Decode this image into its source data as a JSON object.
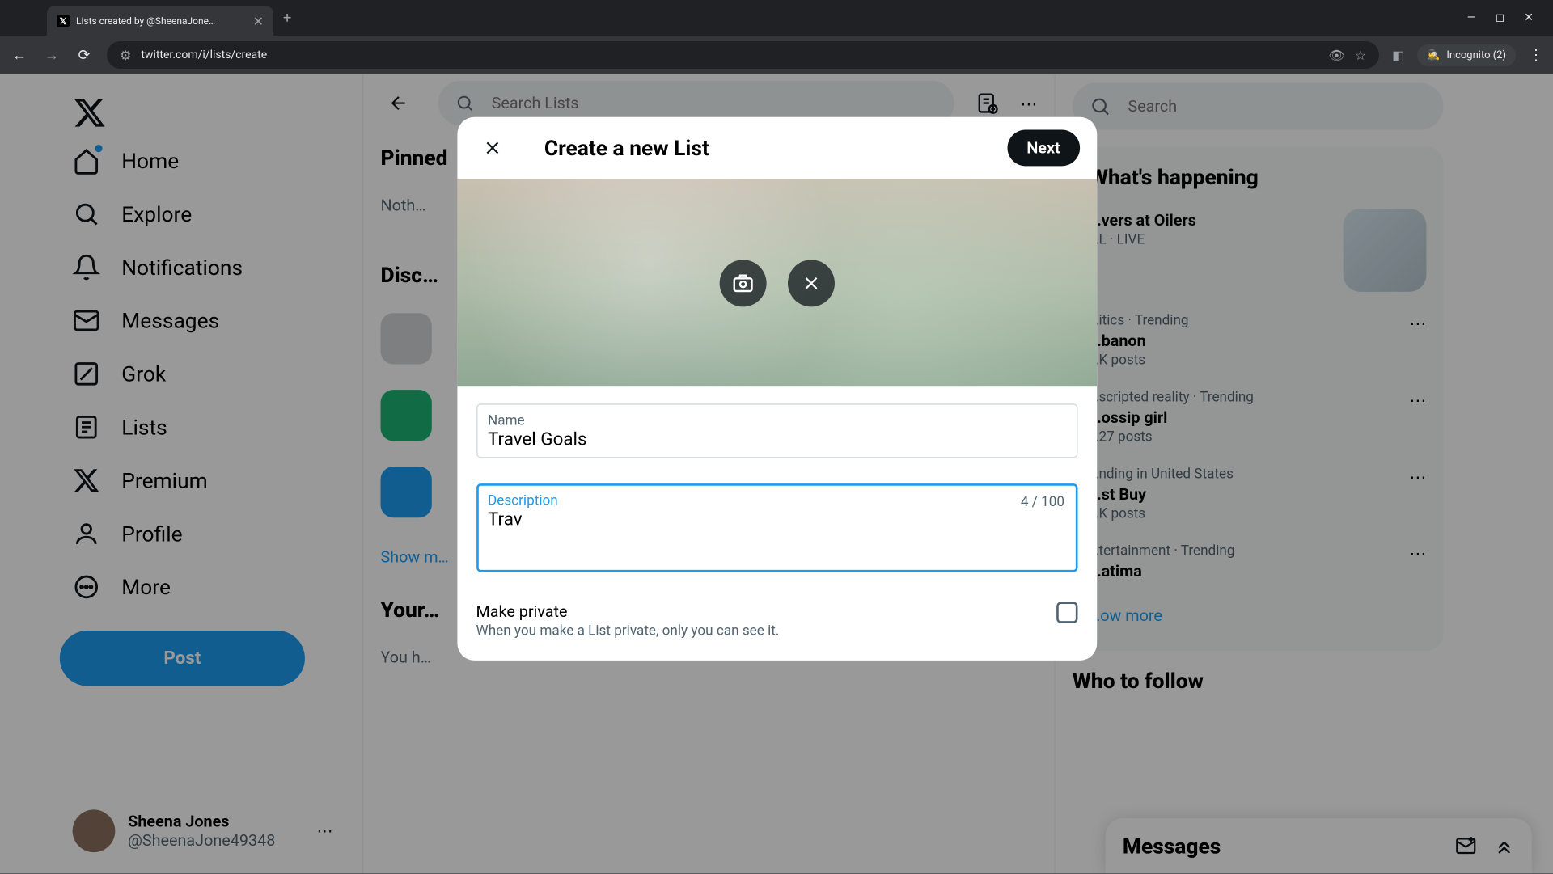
{
  "browser": {
    "tab_title": "Lists created by @SheenaJone…",
    "url": "twitter.com/i/lists/create",
    "incognito_label": "Incognito (2)"
  },
  "sidebar": {
    "items": [
      {
        "label": "Home"
      },
      {
        "label": "Explore"
      },
      {
        "label": "Notifications"
      },
      {
        "label": "Messages"
      },
      {
        "label": "Grok"
      },
      {
        "label": "Lists"
      },
      {
        "label": "Premium"
      },
      {
        "label": "Profile"
      },
      {
        "label": "More"
      }
    ],
    "post_label": "Post",
    "user": {
      "name": "Sheena Jones",
      "handle": "@SheenaJone49348"
    }
  },
  "main": {
    "search_placeholder": "Search Lists",
    "pinned_title": "Pinned",
    "pinned_empty": "Noth…",
    "discover_title": "Disc…",
    "show_more": "Show m…",
    "your_lists_title": "Your…",
    "your_lists_empty": "You h…"
  },
  "right": {
    "search_placeholder": "Search",
    "happening_title": "What's happening",
    "event": {
      "title": "…vers at Oilers",
      "meta": "…L · LIVE"
    },
    "trends": [
      {
        "meta": "…itics · Trending",
        "name": "…banon",
        "count": "…K posts"
      },
      {
        "meta": "…scripted reality · Trending",
        "name": "…ossip girl",
        "count": "…27 posts"
      },
      {
        "meta": "…nding in United States",
        "name": "…st Buy",
        "count": "…K posts"
      },
      {
        "meta": "…tertainment · Trending",
        "name": "…atima",
        "count": ""
      }
    ],
    "show_more": "…ow more",
    "who_to_follow": "Who to follow"
  },
  "messages_dock": {
    "title": "Messages"
  },
  "modal": {
    "title": "Create a new List",
    "next_label": "Next",
    "name_label": "Name",
    "name_value": "Travel Goals",
    "desc_label": "Description",
    "desc_value": "Trav",
    "desc_counter": "4 / 100",
    "private_label": "Make private",
    "private_hint": "When you make a List private, only you can see it."
  }
}
